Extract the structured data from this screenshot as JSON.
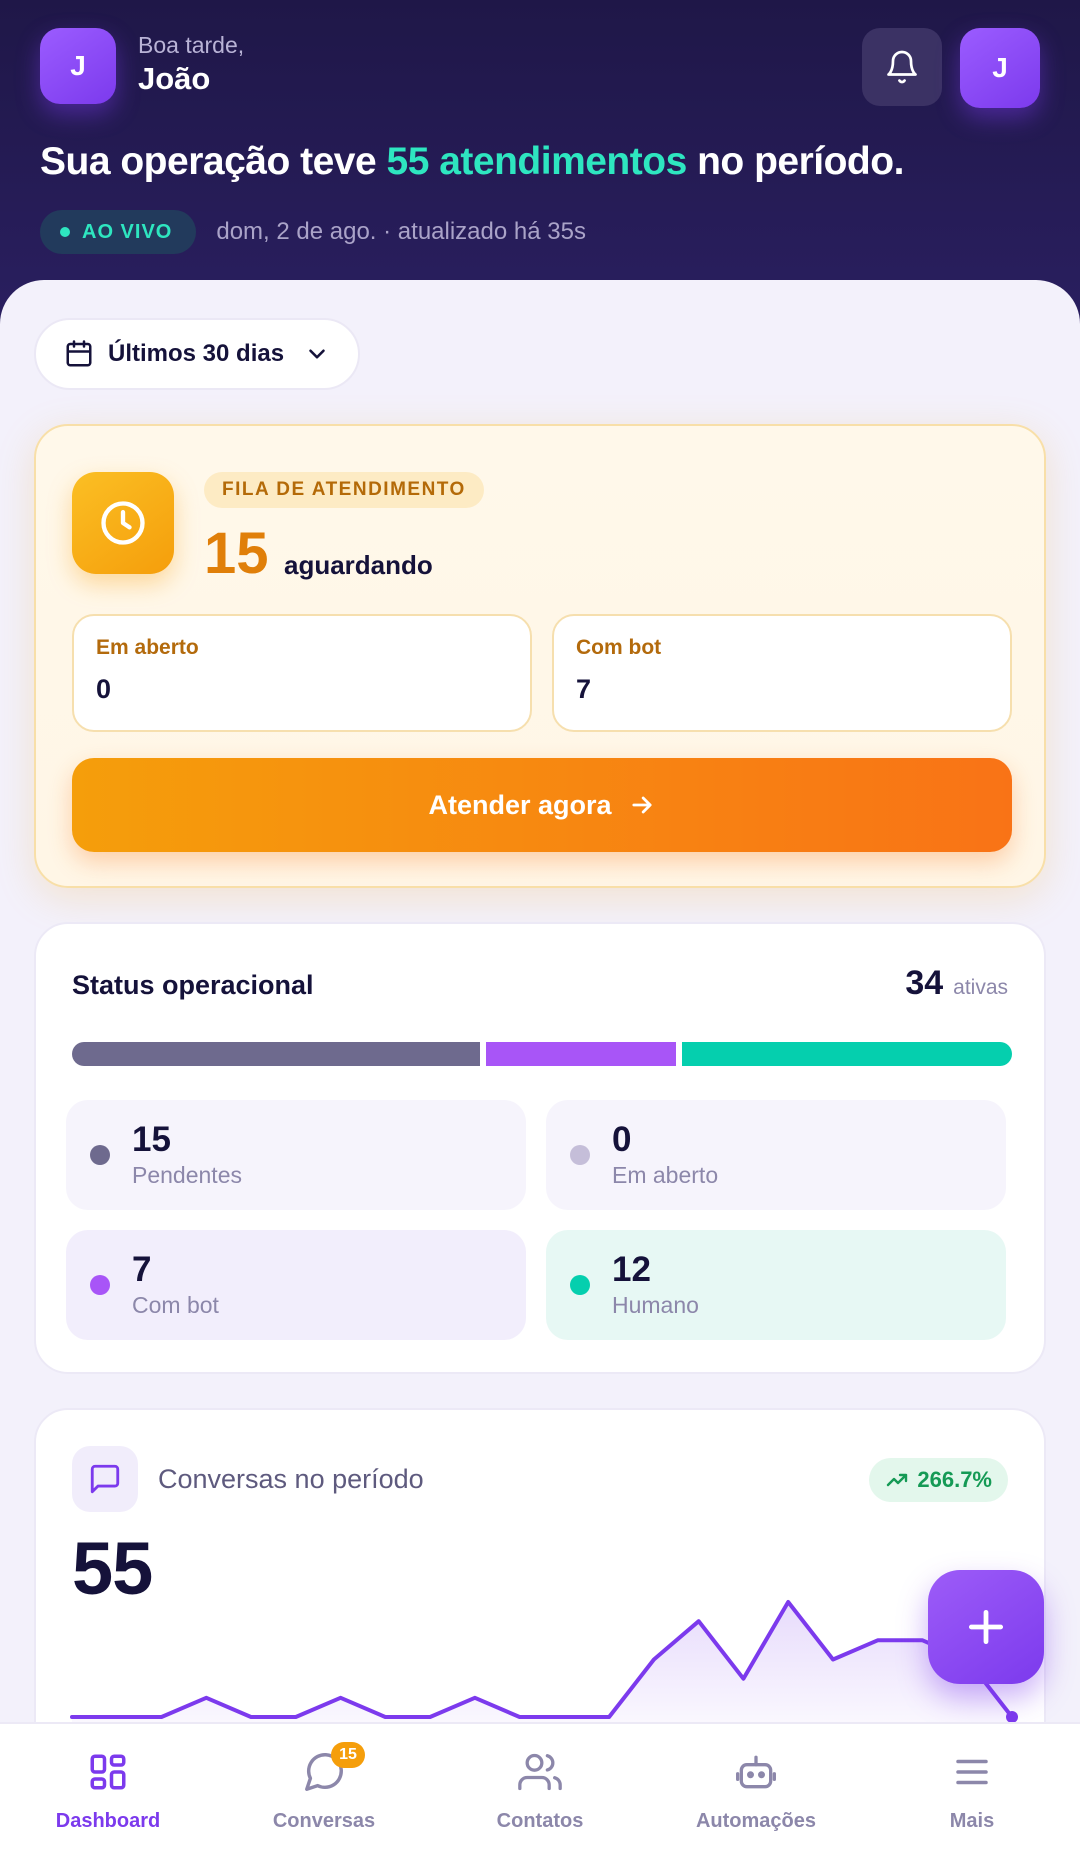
{
  "header": {
    "avatar_initial": "J",
    "greeting": "Boa tarde,",
    "user_name": "João",
    "headline_pre": "Sua operação teve ",
    "headline_highlight": "55 atendimentos",
    "headline_post": " no período.",
    "live_label": "AO VIVO",
    "live_meta": "dom, 2 de ago. · atualizado há 35s"
  },
  "period": {
    "label": "Últimos 30 dias"
  },
  "queue": {
    "tag": "FILA DE ATENDIMENTO",
    "count": "15",
    "count_label": "aguardando",
    "open_label": "Em aberto",
    "open_value": "0",
    "bot_label": "Com bot",
    "bot_value": "7",
    "cta_label": "Atender agora"
  },
  "status": {
    "title": "Status operacional",
    "active_count": "34",
    "active_label": "ativas",
    "items": [
      {
        "value": "15",
        "label": "Pendentes",
        "color": "#6e6a8e"
      },
      {
        "value": "0",
        "label": "Em aberto",
        "color": "#c5bed9"
      },
      {
        "value": "7",
        "label": "Com bot",
        "color": "#a855f7"
      },
      {
        "value": "12",
        "label": "Humano",
        "color": "#05cfae"
      }
    ]
  },
  "conversations": {
    "title": "Conversas no período",
    "growth": "266.7%",
    "total": "55"
  },
  "chart_data": {
    "type": "line",
    "series": [
      {
        "values": [
          0,
          0,
          0,
          1,
          0,
          0,
          1,
          0,
          0,
          1,
          0,
          0,
          0,
          3,
          5,
          2,
          6,
          3,
          4,
          4,
          3,
          0
        ]
      }
    ],
    "ylim": [
      0,
      6
    ],
    "grid": false
  },
  "tabs": [
    {
      "label": "Dashboard",
      "icon": "dashboard-icon"
    },
    {
      "label": "Conversas",
      "icon": "chat-icon",
      "badge": "15"
    },
    {
      "label": "Contatos",
      "icon": "contacts-icon"
    },
    {
      "label": "Automações",
      "icon": "robot-icon"
    },
    {
      "label": "Mais",
      "icon": "menu-icon"
    }
  ],
  "colors": {
    "accent": "#7c3aed",
    "highlight": "#2ee6c0",
    "warning": "#f59e0b"
  }
}
